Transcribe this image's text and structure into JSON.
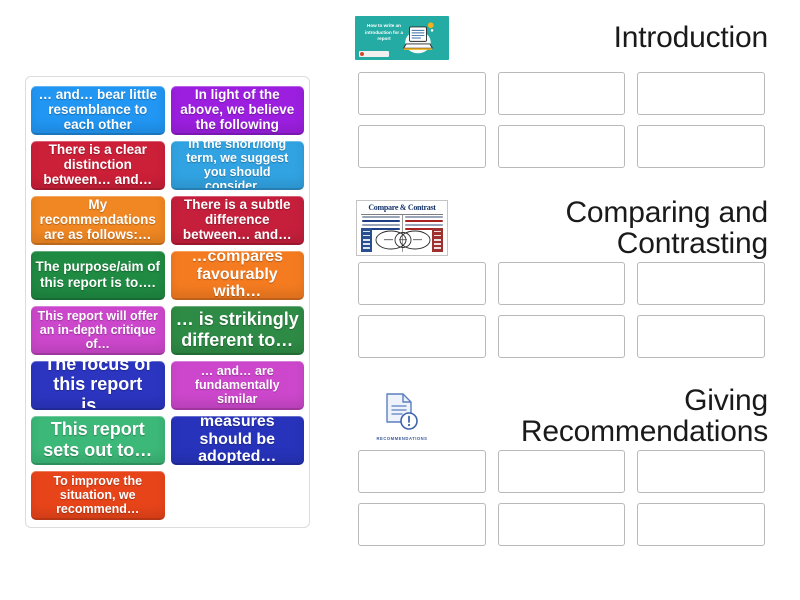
{
  "tray": {
    "name": "draggable-answer-tiles",
    "tiles": [
      {
        "text": "… and… bear little resemblance to each other",
        "color": "#2196f3",
        "size": "fs-13"
      },
      {
        "text": "In light of the above, we believe the following",
        "color": "#9c1fe0",
        "size": "fs-13"
      },
      {
        "text": "There is a clear distinction between… and…",
        "color": "#cc1f38",
        "size": "fs-13"
      },
      {
        "text": "in the short/long term, we suggest you should consider…",
        "color": "#31a3e2",
        "size": "fs-12"
      },
      {
        "text": "My recommendations are as follows:…",
        "color": "#f08722",
        "size": "fs-13"
      },
      {
        "text": "There is a subtle difference between… and…",
        "color": "#c51f3c",
        "size": "fs-13"
      },
      {
        "text": "The purpose/aim of this report is to….",
        "color": "#1f8a42",
        "size": "fs-13"
      },
      {
        "text": "…compares favourably with…",
        "color": "#f47b20",
        "size": "fs-15"
      },
      {
        "text": "This report will offer an in-depth critique of…",
        "color": "#cc47cc",
        "size": "fs-12"
      },
      {
        "text": "… is strikingly different to…",
        "color": "#2e8b45",
        "size": "fs-17"
      },
      {
        "text": "The focus of this report is…",
        "color": "#2b35c0",
        "size": "fs-17"
      },
      {
        "text": "… and… are fundamentally similar",
        "color": "#cc47cc",
        "size": "fs-12"
      },
      {
        "text": "This report sets out to…",
        "color": "#3cb878",
        "size": "fs-17"
      },
      {
        "text": "measures should be adopted…",
        "color": "#2733bb",
        "size": "fs-15"
      },
      {
        "text": "To improve the situation, we recommend…",
        "color": "#e8441a",
        "size": "fs-12"
      }
    ]
  },
  "categories": [
    {
      "title": "Introduction",
      "thumb": "intro-banner-thumbnail",
      "thumb_text": "How to write an introduction for a report",
      "zone_count": 6
    },
    {
      "title": "Comparing and Contrasting",
      "thumb": "compare-contrast-poster-thumbnail",
      "thumb_text": "Compare & Contrast",
      "zone_count": 6
    },
    {
      "title": "Giving Recommendations",
      "thumb": "recommendations-document-icon",
      "thumb_text": "RECOMMENDATIONS",
      "zone_count": 6
    }
  ],
  "colors": {
    "page_background": "#ffffff",
    "tray_border": "#dcdcdc",
    "zone_border": "#b9b9b9",
    "heading_text": "#1a1a1a",
    "intro_banner": "#23aba4"
  }
}
